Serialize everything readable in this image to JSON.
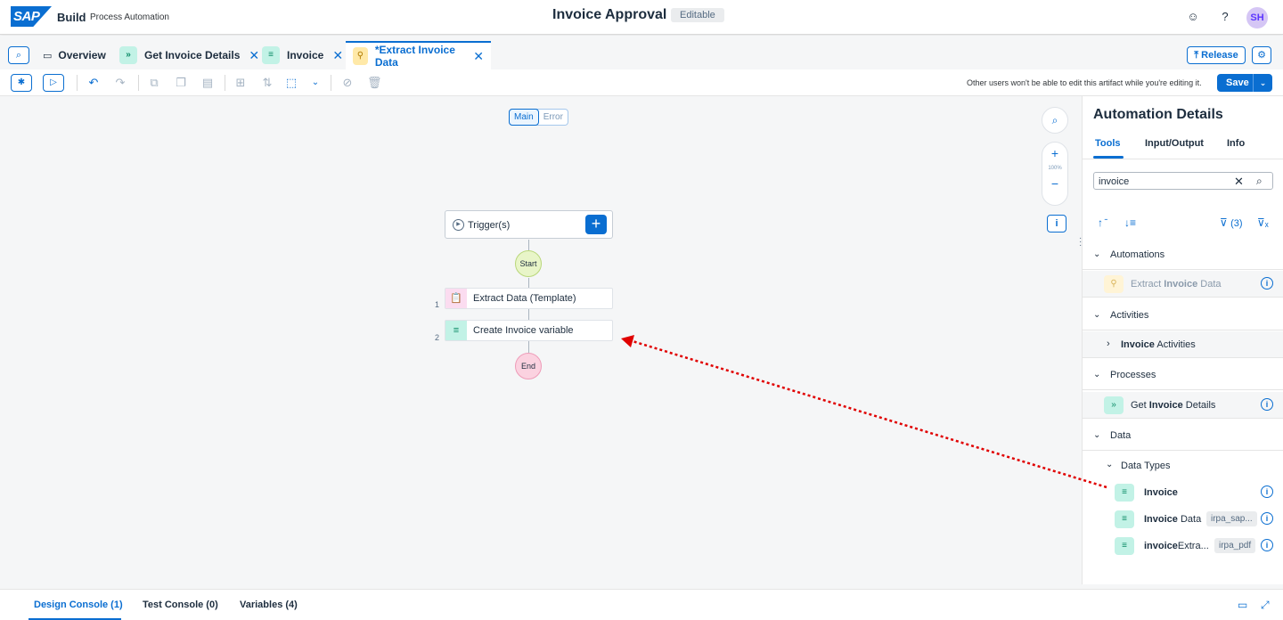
{
  "shell": {
    "logo": "SAP",
    "brand": "Build",
    "product": "Process Automation",
    "title": "Invoice Approval",
    "status": "Editable",
    "avatar": "SH"
  },
  "tabs": [
    {
      "label": "Overview",
      "icon": "folder-icon"
    },
    {
      "label": "Get Invoice Details",
      "icon": "process-icon"
    },
    {
      "label": "Invoice",
      "icon": "datatype-icon"
    },
    {
      "label": "*Extract Invoice Data",
      "icon": "automation-icon"
    }
  ],
  "actions": {
    "release": "Release",
    "save": "Save"
  },
  "toolbar": {
    "lock_message": "Other users won't be able to edit this artifact while you're editing it."
  },
  "canvas": {
    "segments": [
      "Main",
      "Error"
    ],
    "zoom": "100%",
    "trigger_label": "Trigger(s)",
    "start": "Start",
    "end": "End",
    "steps": [
      {
        "num": "1",
        "label": "Extract Data (Template)"
      },
      {
        "num": "2",
        "label": "Create Invoice variable"
      }
    ]
  },
  "panel": {
    "title": "Automation Details",
    "tabs": [
      "Tools",
      "Input/Output",
      "Info"
    ],
    "search_value": "invoice",
    "filter_count": "(3)",
    "sections": {
      "automations": "Automations",
      "activities": "Activities",
      "processes": "Processes",
      "data": "Data",
      "data_types": "Data Types"
    },
    "items": {
      "automation": {
        "pre": "Extract ",
        "bold": "Invoice",
        "post": " Data"
      },
      "activity": {
        "bold": "Invoice",
        "post": " Activities"
      },
      "process": {
        "pre": "Get ",
        "bold": "Invoice",
        "post": " Details"
      },
      "dt1": {
        "bold": "Invoice"
      },
      "dt2": {
        "bold": "Invoice",
        "post": " Data",
        "tag": "irpa_sap..."
      },
      "dt3": {
        "bold": "invoice",
        "post": "Extra...",
        "tag": "irpa_pdf"
      }
    }
  },
  "bottom": {
    "tabs": [
      "Design Console (1)",
      "Test Console (0)",
      "Variables (4)"
    ]
  },
  "colors": {
    "accent": "#0a6ed1",
    "arrow": "#e00000"
  }
}
